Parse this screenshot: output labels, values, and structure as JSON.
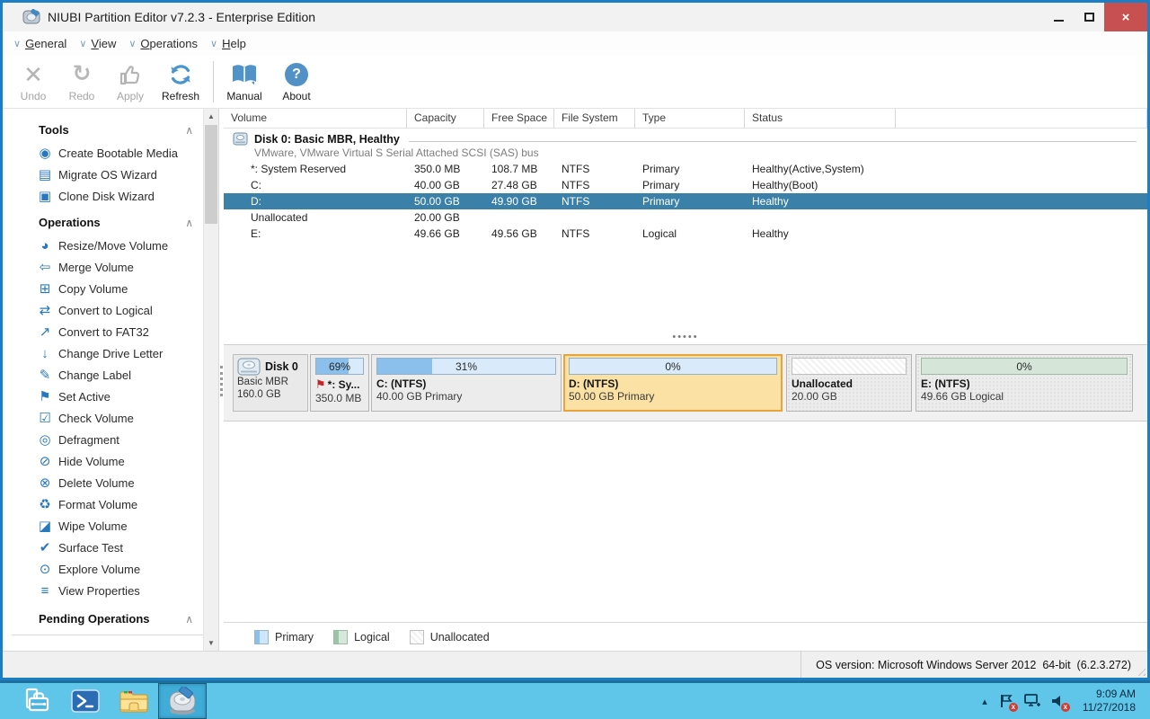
{
  "window": {
    "title": "NIUBI Partition Editor v7.2.3 - Enterprise Edition",
    "close_glyph": "×"
  },
  "menu": {
    "items": [
      {
        "first": "G",
        "rest": "eneral"
      },
      {
        "first": "V",
        "rest": "iew"
      },
      {
        "first": "O",
        "rest": "perations"
      },
      {
        "first": "H",
        "rest": "elp"
      }
    ],
    "chevron_glyph": "∨"
  },
  "toolbar": {
    "undo": "Undo",
    "redo": "Redo",
    "apply": "Apply",
    "refresh": "Refresh",
    "manual": "Manual",
    "about": "About",
    "undo_glyph": "✕",
    "redo_glyph": "↻",
    "about_glyph": "?"
  },
  "sidebar": {
    "tools": {
      "title": "Tools",
      "items": [
        {
          "label": "Create Bootable Media",
          "glyph": "◉"
        },
        {
          "label": "Migrate OS Wizard",
          "glyph": "▤"
        },
        {
          "label": "Clone Disk Wizard",
          "glyph": "▣"
        }
      ]
    },
    "operations": {
      "title": "Operations",
      "items": [
        {
          "label": "Resize/Move Volume",
          "glyph": "◕"
        },
        {
          "label": "Merge Volume",
          "glyph": "⇦"
        },
        {
          "label": "Copy Volume",
          "glyph": "⊞"
        },
        {
          "label": "Convert to Logical",
          "glyph": "⇄"
        },
        {
          "label": "Convert to FAT32",
          "glyph": "↗"
        },
        {
          "label": "Change Drive Letter",
          "glyph": "↓"
        },
        {
          "label": "Change Label",
          "glyph": "✎"
        },
        {
          "label": "Set Active",
          "glyph": "⚑"
        },
        {
          "label": "Check Volume",
          "glyph": "☑"
        },
        {
          "label": "Defragment",
          "glyph": "◎"
        },
        {
          "label": "Hide Volume",
          "glyph": "⊘"
        },
        {
          "label": "Delete Volume",
          "glyph": "⊗"
        },
        {
          "label": "Format Volume",
          "glyph": "♻"
        },
        {
          "label": "Wipe Volume",
          "glyph": "◪"
        },
        {
          "label": "Surface Test",
          "glyph": "✔"
        },
        {
          "label": "Explore Volume",
          "glyph": "⊙"
        },
        {
          "label": "View Properties",
          "glyph": "≡"
        }
      ]
    },
    "pending": {
      "title": "Pending Operations"
    },
    "collapse_glyph": "∧",
    "scroll_up_glyph": "▲",
    "scroll_down_glyph": "▼"
  },
  "volume_table": {
    "columns": {
      "volume": "Volume",
      "capacity": "Capacity",
      "free_space": "Free Space",
      "file_system": "File System",
      "type": "Type",
      "status": "Status"
    },
    "disk_group": {
      "title": "Disk 0: Basic MBR, Healthy",
      "subtitle": "VMware, VMware Virtual S Serial Attached SCSI (SAS) bus"
    },
    "rows": [
      {
        "volume": "*: System Reserved",
        "capacity": "350.0 MB",
        "free_space": "108.7 MB",
        "file_system": "NTFS",
        "type": "Primary",
        "status": "Healthy(Active,System)"
      },
      {
        "volume": "C:",
        "capacity": "40.00 GB",
        "free_space": "27.48 GB",
        "file_system": "NTFS",
        "type": "Primary",
        "status": "Healthy(Boot)"
      },
      {
        "volume": "D:",
        "capacity": "50.00 GB",
        "free_space": "49.90 GB",
        "file_system": "NTFS",
        "type": "Primary",
        "status": "Healthy"
      },
      {
        "volume": "Unallocated",
        "capacity": "20.00 GB",
        "free_space": "",
        "file_system": "",
        "type": "",
        "status": ""
      },
      {
        "volume": "E:",
        "capacity": "49.66 GB",
        "free_space": "49.56 GB",
        "file_system": "NTFS",
        "type": "Logical",
        "status": "Healthy"
      }
    ],
    "selected_row_color": "#3b80a8"
  },
  "splitter_dots": "•••••",
  "disk_map": {
    "disk": {
      "name": "Disk 0",
      "layout": "Basic MBR",
      "size": "160.0 GB"
    },
    "partitions": [
      {
        "name": "*: Sy...",
        "size": "350.0 MB",
        "usage": "69%",
        "flag_glyph": "⚑"
      },
      {
        "name": "C: (NTFS)",
        "size": "40.00 GB Primary",
        "usage": "31%"
      },
      {
        "name": "D: (NTFS)",
        "size": "50.00 GB Primary",
        "usage": "0%"
      },
      {
        "name": "Unallocated",
        "size": "20.00 GB",
        "usage": ""
      },
      {
        "name": "E: (NTFS)",
        "size": "49.66 GB Logical",
        "usage": "0%"
      }
    ],
    "selected_border_color": "#e8a33d",
    "primary_fill_color": "#8cc0ec"
  },
  "legend": {
    "primary": "Primary",
    "logical": "Logical",
    "unallocated": "Unallocated"
  },
  "status_bar": {
    "os_version": "OS version: Microsoft Windows Server 2012  64-bit  (6.2.3.272)"
  },
  "taskbar": {
    "tray": {
      "time": "9:09 AM",
      "date": "11/27/2018",
      "hidden_icons_glyph": "▴"
    },
    "colors": {
      "background": "#5fc6ea",
      "active_app": "#3fadd8"
    }
  }
}
